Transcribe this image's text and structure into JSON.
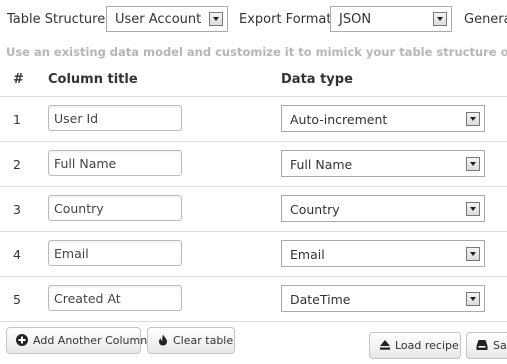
{
  "toolbar": {
    "table_structure_label": "Table Structure:",
    "table_structure_value": "User Account",
    "export_format_label": "Export Format:",
    "export_format_value": "JSON",
    "generate_label": "Genera"
  },
  "hint": "Use an existing data model and customize it to mimick your table structure or create one",
  "table": {
    "headers": {
      "index": "#",
      "column_title": "Column title",
      "data_type": "Data type"
    },
    "rows": [
      {
        "num": "1",
        "title": "User Id",
        "type": "Auto-increment"
      },
      {
        "num": "2",
        "title": "Full Name",
        "type": "Full Name"
      },
      {
        "num": "3",
        "title": "Country",
        "type": "Country"
      },
      {
        "num": "4",
        "title": "Email",
        "type": "Email"
      },
      {
        "num": "5",
        "title": "Created At",
        "type": "DateTime"
      }
    ]
  },
  "buttons": {
    "add_column": "Add Another Column",
    "clear_table": "Clear table",
    "load_recipe": "Load recipe",
    "save": "Sa"
  }
}
